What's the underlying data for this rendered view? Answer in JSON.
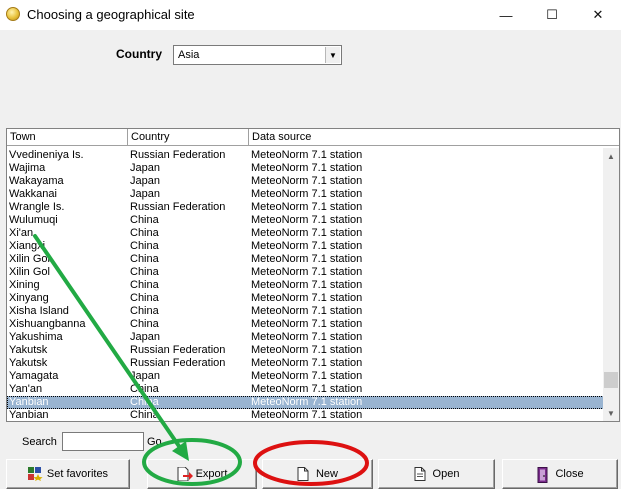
{
  "window": {
    "title": "Choosing a geographical site",
    "controls": {
      "minimize": "—",
      "maximize": "☐",
      "close": "✕"
    }
  },
  "country": {
    "label": "Country",
    "value": "Asia"
  },
  "table": {
    "columns": [
      "Town",
      "Country",
      "Data source"
    ],
    "rows": [
      [
        "Vvedineniya Is.",
        "Russian Federation",
        "MeteoNorm 7.1 station"
      ],
      [
        "Wajima",
        "Japan",
        "MeteoNorm 7.1 station"
      ],
      [
        "Wakayama",
        "Japan",
        "MeteoNorm 7.1 station"
      ],
      [
        "Wakkanai",
        "Japan",
        "MeteoNorm 7.1 station"
      ],
      [
        "Wrangle Is.",
        "Russian Federation",
        "MeteoNorm 7.1 station"
      ],
      [
        "Wulumuqi",
        "China",
        "MeteoNorm 7.1 station"
      ],
      [
        "Xi'an",
        "China",
        "MeteoNorm 7.1 station"
      ],
      [
        "Xiangxi",
        "China",
        "MeteoNorm 7.1 station"
      ],
      [
        "Xilin Gol",
        "China",
        "MeteoNorm 7.1 station"
      ],
      [
        "Xilin Gol",
        "China",
        "MeteoNorm 7.1 station"
      ],
      [
        "Xining",
        "China",
        "MeteoNorm 7.1 station"
      ],
      [
        "Xinyang",
        "China",
        "MeteoNorm 7.1 station"
      ],
      [
        "Xisha Island",
        "China",
        "MeteoNorm 7.1 station"
      ],
      [
        "Xishuangbanna",
        "China",
        "MeteoNorm 7.1 station"
      ],
      [
        "Yakushima",
        "Japan",
        "MeteoNorm 7.1 station"
      ],
      [
        "Yakutsk",
        "Russian Federation",
        "MeteoNorm 7.1 station"
      ],
      [
        "Yakutsk",
        "Russian Federation",
        "MeteoNorm 7.1 station"
      ],
      [
        "Yamagata",
        "Japan",
        "MeteoNorm 7.1 station"
      ],
      [
        "Yan'an",
        "China",
        "MeteoNorm 7.1 station"
      ],
      [
        "Yanbian",
        "China",
        "MeteoNorm 7.1 station"
      ],
      [
        "Yanbian",
        "China",
        "MeteoNorm 7.1 station"
      ]
    ],
    "selected_row": 19
  },
  "search": {
    "label": "Search",
    "value": "",
    "go_label": "Go"
  },
  "buttons": {
    "set_favorites": "Set favorites",
    "export": "Export",
    "new": "New",
    "open": "Open",
    "close": "Close"
  },
  "annotations": {
    "arrow_color": "#22aa44",
    "export_circle_color": "#22aa44",
    "new_circle_color": "#dd1111"
  }
}
